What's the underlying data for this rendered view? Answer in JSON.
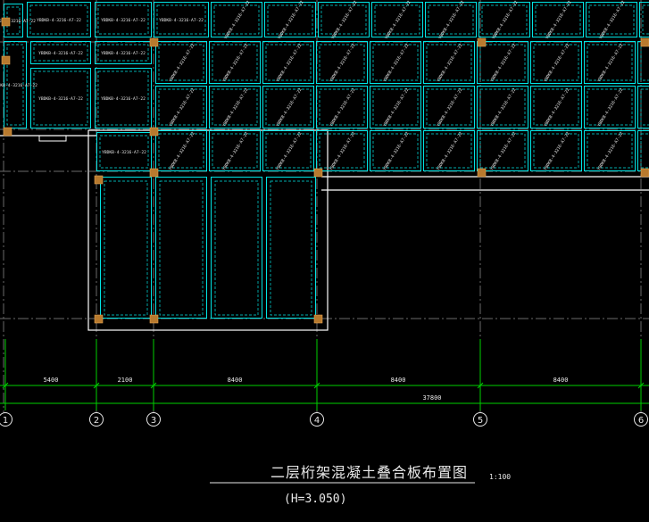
{
  "drawing": {
    "title": "二层桁架混凝土叠合板布置图",
    "scale": "1:100",
    "elevation": "(H=3.050)"
  },
  "axes": {
    "labels": [
      "1",
      "2",
      "3",
      "4",
      "5",
      "6"
    ]
  },
  "dimensions": {
    "segments": [
      "5400",
      "2100",
      "8400",
      "8400",
      "8400"
    ],
    "total": "37800"
  },
  "panels": {
    "label": "YBDKB-4-3216-A7-22"
  },
  "colors": {
    "background": "#000000",
    "panel_outline": "#00e5e5",
    "beam_line": "#ffffff",
    "axis_line": "#00d000",
    "column": "#b87a2e",
    "text": "#e8e8e8"
  }
}
